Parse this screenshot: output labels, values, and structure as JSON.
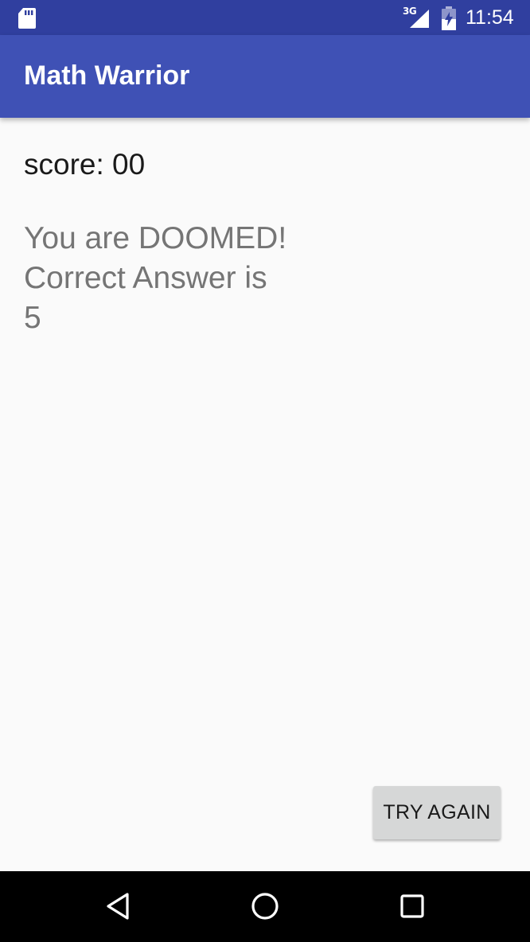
{
  "status_bar": {
    "network": "3G",
    "time": "11:54",
    "icons": [
      "sd-card-icon",
      "signal-icon",
      "battery-icon"
    ],
    "bg_color": "#303f9f"
  },
  "app_bar": {
    "title": "Math Warrior",
    "bg_color": "#3f51b5"
  },
  "game": {
    "score_text": "score: 00",
    "message_lines": [
      "You are DOOMED!",
      "Correct Answer is",
      "5"
    ]
  },
  "actions": {
    "try_again_label": "TRY AGAIN"
  },
  "nav_bar": {
    "buttons": [
      "back-icon",
      "home-icon",
      "recents-icon"
    ]
  }
}
